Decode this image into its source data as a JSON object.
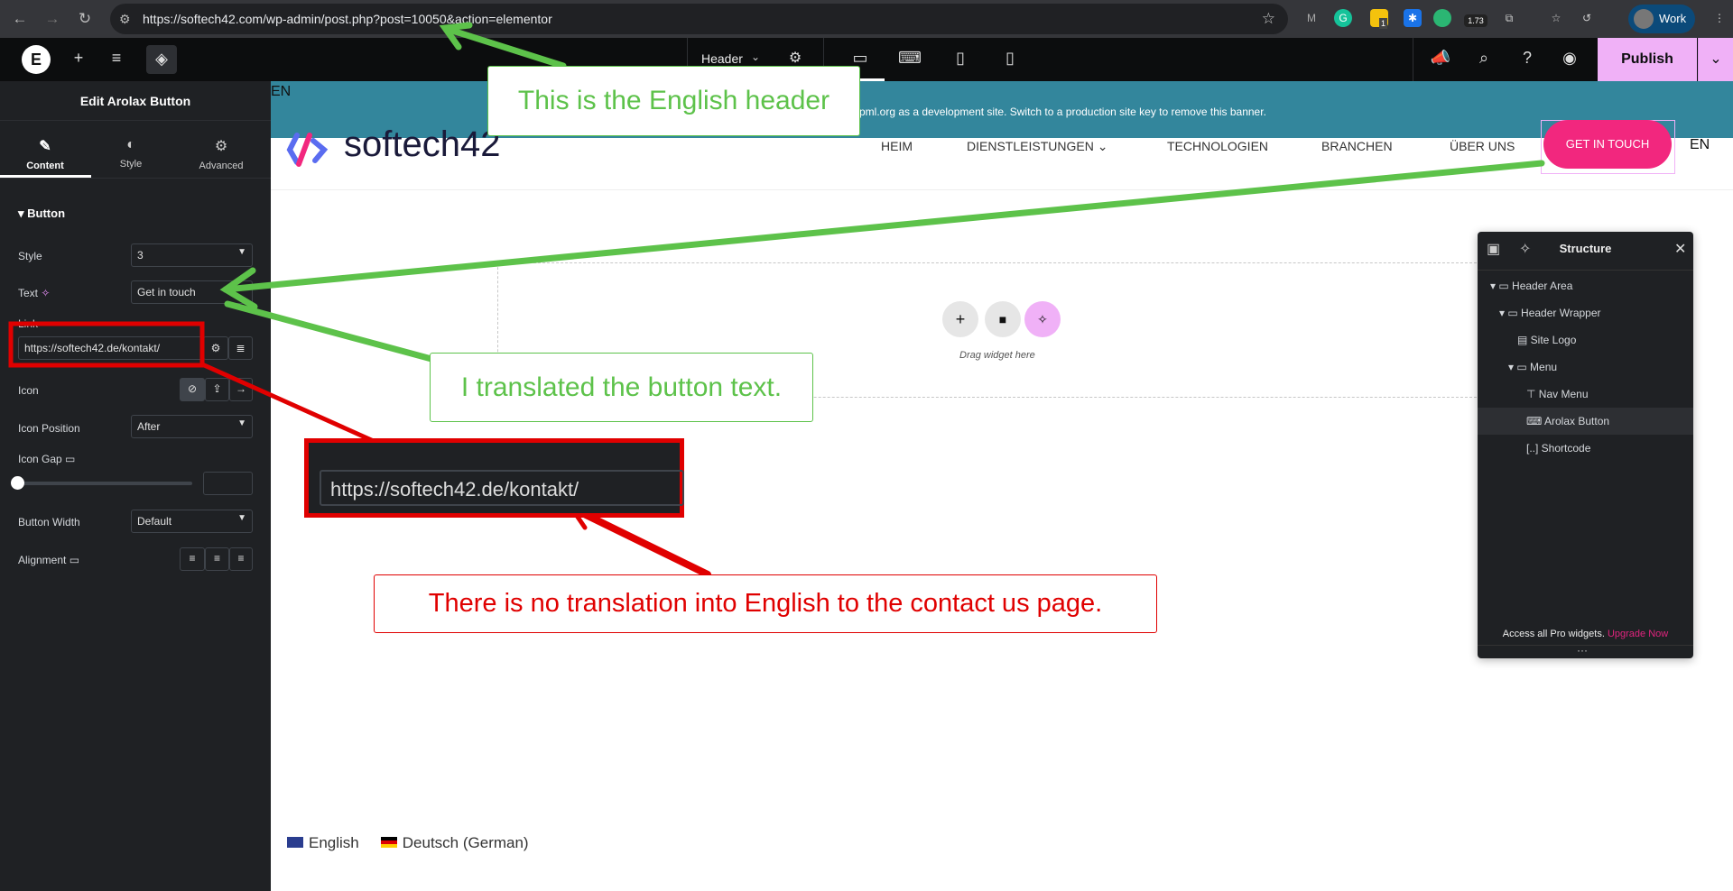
{
  "browser": {
    "url": "https://softech42.com/wp-admin/post.php?post=10050&action=elementor",
    "extension_badge_1": "1",
    "extension_badge_2": "1.73",
    "profile_label": "Work"
  },
  "topbar": {
    "document_label": "Header",
    "publish_label": "Publish"
  },
  "panel": {
    "title": "Edit Arolax Button",
    "tabs": [
      {
        "label": "Content",
        "icon": "pencil-icon"
      },
      {
        "label": "Style",
        "icon": "contrast-icon"
      },
      {
        "label": "Advanced",
        "icon": "gear-icon"
      }
    ],
    "section_title": "Button",
    "style_label": "Style",
    "style_value": "3",
    "text_label": "Text",
    "text_value": "Get in touch",
    "link_label": "Link",
    "link_value": "https://softech42.de/kontakt/",
    "icon_label": "Icon",
    "icon_position_label": "Icon Position",
    "icon_position_value": "After",
    "icon_gap_label": "Icon Gap",
    "icon_gap_value": 0,
    "button_width_label": "Button Width",
    "button_width_value": "Default",
    "alignment_label": "Alignment"
  },
  "site": {
    "lang_code": "EN",
    "banner_text": "pml.org as a development site. Switch to a production site key to remove this banner.",
    "logo_text": "softech42",
    "nav": [
      "HEIM",
      "DIENSTLEISTUNGEN",
      "TECHNOLOGIEN",
      "BRANCHEN",
      "ÜBER UNS"
    ],
    "cta": "GET IN TOUCH",
    "lang_code_right": "EN",
    "drag_hint": "Drag widget here",
    "languages": [
      {
        "label": "English"
      },
      {
        "label": "Deutsch (German)"
      }
    ]
  },
  "structure": {
    "title": "Structure",
    "items": [
      {
        "label": "Header Area",
        "level": 0,
        "expanded": true
      },
      {
        "label": "Header Wrapper",
        "level": 1,
        "expanded": true
      },
      {
        "label": "Site Logo",
        "level": 2
      },
      {
        "label": "Menu",
        "level": 2,
        "expanded": true
      },
      {
        "label": "Nav Menu",
        "level": 3
      },
      {
        "label": "Arolax Button",
        "level": 3,
        "selected": true
      },
      {
        "label": "Shortcode",
        "level": 3
      }
    ],
    "promo_text": "Access all Pro widgets.",
    "promo_link": "Upgrade Now"
  },
  "annotations": {
    "english_header": "This is the English header",
    "translated_text": "I translated the button text.",
    "zoomed_url": "https://softech42.de/kontakt/",
    "no_translation": "There is no translation into English to the contact us page."
  },
  "colors": {
    "accent_pink": "#f2277e",
    "publish": "#f0b1f7",
    "banner": "#33869c",
    "annotation_green": "#5dc24a",
    "annotation_red": "#e00000"
  }
}
